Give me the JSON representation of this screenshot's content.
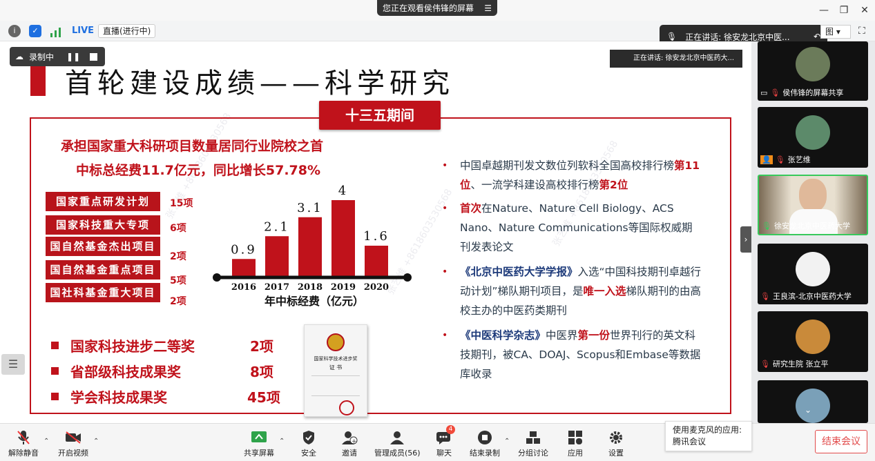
{
  "top": {
    "viewing_label": "您正在观看侯伟锋的屏幕",
    "live_badge": "LIVE",
    "live_status": "直播(进行中)",
    "speaking": "正在讲话: 徐安龙北京中医...",
    "view_label": "图"
  },
  "recording": {
    "label": "录制中"
  },
  "slide": {
    "title": "首轮建设成绩——科学研究",
    "period": "十三五期间",
    "slide_speaking": "正在讲话: 徐安龙北京中医药大...",
    "headline1": "承担国家重大科研项目数量居同行业院校之首",
    "headline2": "中标总经费11.7亿元，同比增长57.78%",
    "projects": [
      {
        "label": "国家重点研发计划",
        "count": "15项"
      },
      {
        "label": "国家科技重大专项",
        "count": "6项"
      },
      {
        "label": "国自然基金杰出项目",
        "count": "2项"
      },
      {
        "label": "国自然基金重点项目",
        "count": "5项"
      },
      {
        "label": "国社科基金重大项目",
        "count": "2项"
      }
    ],
    "awards": [
      {
        "label": "国家科技进步二等奖",
        "count": "2项"
      },
      {
        "label": "省部级科技成果奖",
        "count": "8项"
      },
      {
        "label": "学会科技成果奖",
        "count": "45项"
      }
    ],
    "certificate": {
      "line1": "国家科学技术进步奖",
      "line2": "证 书"
    },
    "bullets": {
      "b1_pre": "中国卓越期刊发文数位列软科全国高校排行榜",
      "b1_red1": "第11位",
      "b1_mid": "、一流学科建设高校排行榜",
      "b1_red2": "第2位",
      "b2_red": "首次",
      "b2_post": "在Nature、Nature Cell Biology、ACS Nano、Nature Communications等国际权威期刊发表论文",
      "b3_navy": "《北京中医药大学学报》",
      "b3_mid": "入选“中国科技期刊卓越行动计划”梯队期刊项目，是",
      "b3_red": "唯一入选",
      "b3_post": "梯队期刊的由高校主办的中医药类期刊",
      "b4_navy": "《中医科学杂志》",
      "b4_mid": "中医界",
      "b4_red": "第一份",
      "b4_post": "世界刊行的英文科技期刊，被CA、DOAJ、Scopus和Embase等数据库收录"
    }
  },
  "chart_data": {
    "type": "bar",
    "categories": [
      "2016",
      "2017",
      "2018",
      "2019",
      "2020"
    ],
    "values": [
      0.9,
      2.1,
      3.1,
      4,
      1.6
    ],
    "value_labels": [
      "0.9",
      "2.1",
      "3.1",
      "4",
      "1.6"
    ],
    "xlabel": "年中标经费（亿元）",
    "ylim": [
      0,
      4
    ],
    "bar_color": "#c0121b"
  },
  "participants": [
    {
      "name": "侯伟锋的屏幕共享"
    },
    {
      "name": "张艺维"
    },
    {
      "name": "徐安龙北京中医药大学"
    },
    {
      "name": "王良滨-北京中医药大学"
    },
    {
      "name": "研究生院 张立平"
    }
  ],
  "bottom": {
    "unmute": "解除静音",
    "video": "开启视频",
    "share": "共享屏幕",
    "security": "安全",
    "invite": "邀请",
    "members": "管理成员(56)",
    "chat": "聊天",
    "chat_badge": "4",
    "stop_record": "结束录制",
    "breakout": "分组讨论",
    "apps": "应用",
    "settings": "设置",
    "end_meeting": "结束会议",
    "mic_app_line1": "使用麦克风的应用:",
    "mic_app_line2": "腾讯会议"
  },
  "colors": {
    "accent": "#c0121b",
    "navy": "#1d3a7a",
    "live_blue": "#1e6fe0"
  }
}
